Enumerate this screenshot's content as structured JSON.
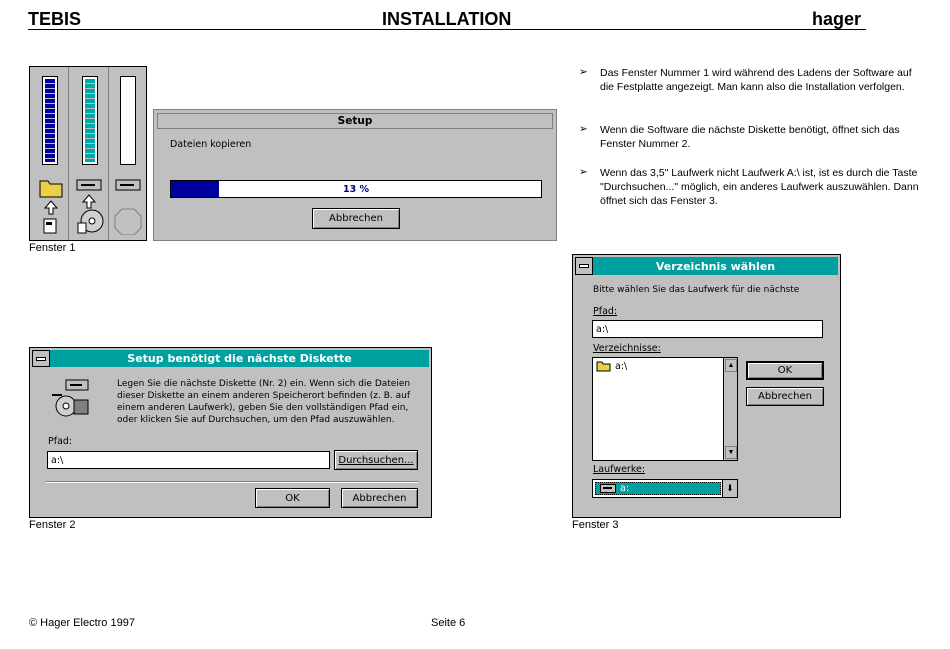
{
  "header": {
    "left": "TEBIS",
    "center": "INSTALLATION",
    "right": "hager"
  },
  "bullets": [
    "Das Fenster Nummer 1 wird während des Ladens der Software auf die Festplatte angezeigt. Man kann also die Installation verfolgen.",
    "Wenn die Software die nächste Diskette benötigt, öffnet sich das Fenster Nummer 2.",
    "Wenn das 3,5\" Laufwerk nicht Laufwerk A:\\ ist, ist es durch die Taste \"Durchsuchen...\" möglich, ein anderes Laufwerk auszuwählen. Dann öffnet sich das Fenster 3."
  ],
  "fenster1": {
    "caption": "Fenster 1",
    "title": "Setup",
    "status": "Dateien kopieren",
    "progress_text": "13 %",
    "progress": 0.13,
    "cancel": "Abbrechen"
  },
  "fenster2": {
    "caption": "Fenster 2",
    "title": "Setup benötigt die nächste Diskette",
    "message": "Legen Sie die nächste Diskette (Nr. 2) ein. Wenn sich die Dateien dieser Diskette an einem anderen Speicherort befinden (z. B. auf einem anderen Laufwerk), geben Sie den vollständigen Pfad ein, oder klicken Sie auf Durchsuchen, um den Pfad auszuwählen.",
    "path_label": "Pfad:",
    "path_value": "a:\\",
    "browse": "Durchsuchen...",
    "ok": "OK",
    "cancel": "Abbrechen"
  },
  "fenster3": {
    "caption": "Fenster 3",
    "title": "Verzeichnis wählen",
    "instruction": "Bitte wählen Sie das Laufwerk für die nächste",
    "path_label": "Pfad:",
    "path_value": "a:\\",
    "dirs_label": "Verzeichnisse:",
    "dir_item": "a:\\",
    "drives_label": "Laufwerke:",
    "drive_value": "a:",
    "ok": "OK",
    "cancel": "Abbrechen"
  },
  "footer": {
    "copyright": "© Hager Electro 1997",
    "page": "Seite 6"
  }
}
